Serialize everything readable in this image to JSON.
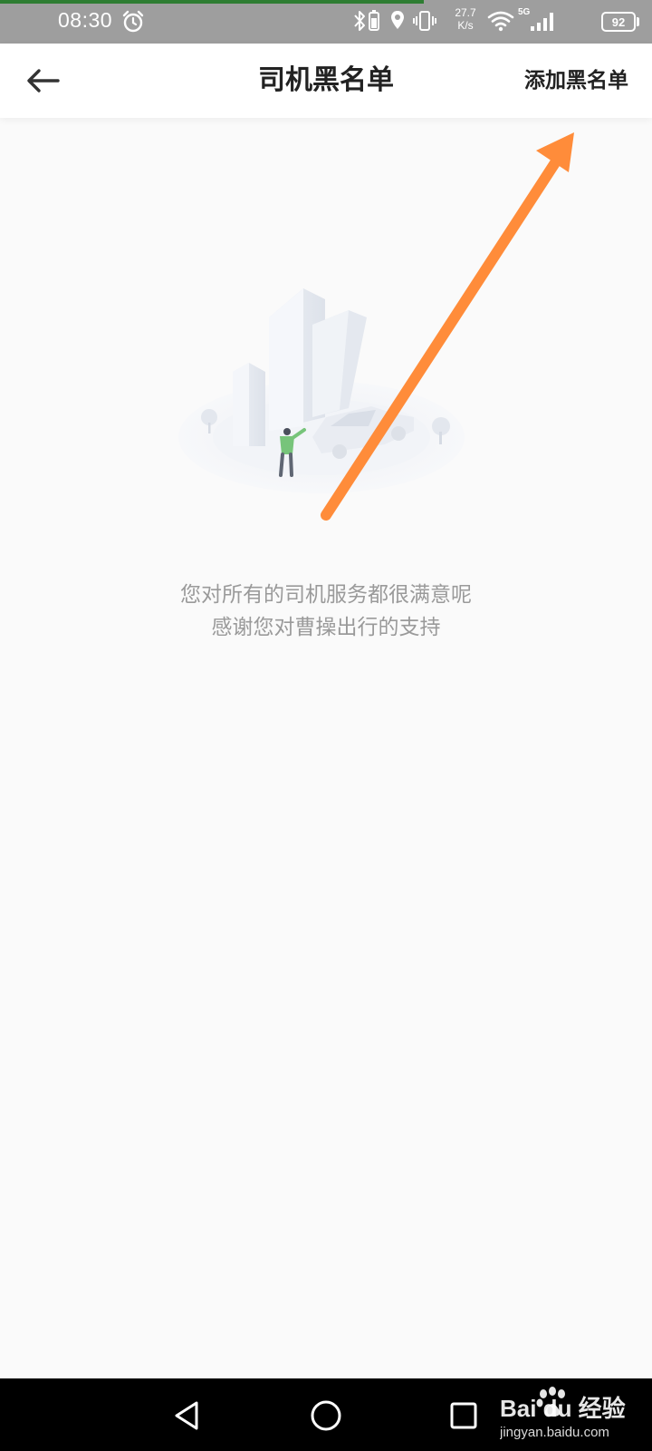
{
  "status_bar": {
    "time": "08:30",
    "net_speed_value": "27.7",
    "net_speed_unit": "K/s",
    "network_type": "5G",
    "battery_level": "92",
    "progress_fraction": 0.65,
    "icons": [
      "alarm-icon",
      "bluetooth-icon",
      "battery-saver-icon",
      "location-icon",
      "vibrate-icon",
      "wifi-icon",
      "signal-icon",
      "battery-icon"
    ]
  },
  "header": {
    "title": "司机黑名单",
    "add_button_label": "添加黑名单",
    "back_icon": "arrow-left-icon"
  },
  "empty_state": {
    "illustration": "city-car-person-illustration",
    "line1": "您对所有的司机服务都很满意呢",
    "line2": "感谢您对曹操出行的支持"
  },
  "annotation": {
    "type": "arrow",
    "color": "#ff8c3a",
    "points_to": "add-blacklist-button"
  },
  "nav_bar": {
    "icons": [
      "back-triangle-icon",
      "home-circle-icon",
      "recents-square-icon"
    ]
  },
  "watermark": {
    "brand": "Bai du 经验",
    "url": "jingyan.baidu.com"
  }
}
